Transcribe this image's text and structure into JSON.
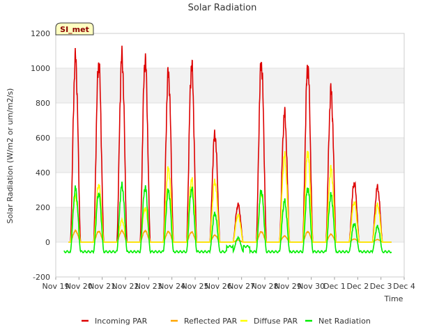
{
  "chart_data": {
    "type": "line",
    "title": "Solar Radiation",
    "xlabel": "Time",
    "ylabel": "Solar Radiation (W/m2 or um/m2/s)",
    "site_label": "SI_met",
    "ylim": [
      -200,
      1200
    ],
    "xlim": [
      0,
      15
    ],
    "yticks": [
      -200,
      0,
      200,
      400,
      600,
      800,
      1000,
      1200
    ],
    "xticks": [
      {
        "x": 0,
        "label": "Nov 19"
      },
      {
        "x": 1,
        "label": "Nov 20"
      },
      {
        "x": 2,
        "label": "Nov 21"
      },
      {
        "x": 3,
        "label": "Nov 22"
      },
      {
        "x": 4,
        "label": "Nov 23"
      },
      {
        "x": 5,
        "label": "Nov 24"
      },
      {
        "x": 6,
        "label": "Nov 25"
      },
      {
        "x": 7,
        "label": "Nov 26"
      },
      {
        "x": 8,
        "label": "Nov 27"
      },
      {
        "x": 9,
        "label": "Nov 28"
      },
      {
        "x": 10,
        "label": "Nov 29"
      },
      {
        "x": 11,
        "label": "Nov 30"
      },
      {
        "x": 12,
        "label": "Dec 1"
      },
      {
        "x": 13,
        "label": "Dec 2"
      },
      {
        "x": 14,
        "label": "Dec 3"
      },
      {
        "x": 15,
        "label": "Dec 4"
      }
    ],
    "grid": "horizontal bands",
    "legend_position": "bottom",
    "x_units": "days since Nov 19 00:00",
    "days": [
      {
        "center": 0.85,
        "incoming": 1055,
        "reflected": 65,
        "diffuse": 265,
        "net": 305
      },
      {
        "center": 1.85,
        "incoming": 1030,
        "reflected": 62,
        "diffuse": 330,
        "net": 280
      },
      {
        "center": 2.85,
        "incoming": 1065,
        "reflected": 65,
        "diffuse": 125,
        "net": 325
      },
      {
        "center": 3.85,
        "incoming": 1050,
        "reflected": 65,
        "diffuse": 195,
        "net": 315
      },
      {
        "center": 4.85,
        "incoming": 970,
        "reflected": 60,
        "diffuse": 420,
        "net": 295
      },
      {
        "center": 5.85,
        "incoming": 1015,
        "reflected": 58,
        "diffuse": 360,
        "net": 305
      },
      {
        "center": 6.85,
        "incoming": 620,
        "reflected": 40,
        "diffuse": 350,
        "net": 165
      },
      {
        "center": 7.85,
        "incoming": 215,
        "reflected": 12,
        "diffuse": 155,
        "net": 25
      },
      {
        "center": 8.85,
        "incoming": 1030,
        "reflected": 60,
        "diffuse": 280,
        "net": 295
      },
      {
        "center": 9.85,
        "incoming": 735,
        "reflected": 35,
        "diffuse": 495,
        "net": 235
      },
      {
        "center": 10.85,
        "incoming": 1010,
        "reflected": 60,
        "diffuse": 520,
        "net": 310
      },
      {
        "center": 11.85,
        "incoming": 865,
        "reflected": 45,
        "diffuse": 420,
        "net": 270
      },
      {
        "center": 12.85,
        "incoming": 340,
        "reflected": 18,
        "diffuse": 230,
        "net": 105
      },
      {
        "center": 13.85,
        "incoming": 315,
        "reflected": 15,
        "diffuse": 215,
        "net": 90
      }
    ],
    "night_net": -55,
    "series": [
      {
        "name": "Incoming PAR",
        "key": "incoming",
        "color": "#dd0000"
      },
      {
        "name": "Reflected PAR",
        "key": "reflected",
        "color": "#ffa500"
      },
      {
        "name": "Diffuse PAR",
        "key": "diffuse",
        "color": "#ffff00"
      },
      {
        "name": "Net Radiation",
        "key": "net",
        "color": "#00ee00"
      }
    ]
  }
}
